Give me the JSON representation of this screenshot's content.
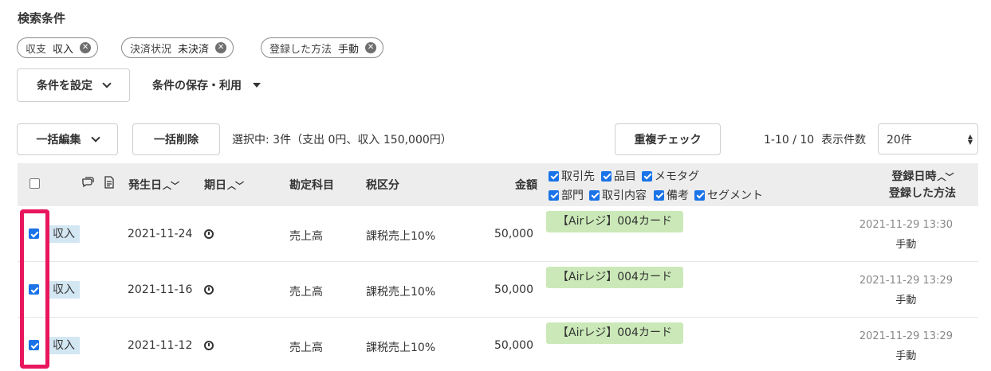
{
  "search": {
    "title": "検索条件",
    "chips": [
      {
        "label": "収支",
        "value": "収入"
      },
      {
        "label": "決済状況",
        "value": "未決済"
      },
      {
        "label": "登録した方法",
        "value": "手動"
      }
    ],
    "set_conditions_label": "条件を設定",
    "save_use_label": "条件の保存・利用"
  },
  "toolbar": {
    "bulk_edit_label": "一括編集",
    "bulk_delete_label": "一括削除",
    "selection_text": "選択中: 3件（支出 0円、収入 150,000円）",
    "duplicate_check_label": "重複チェック",
    "pagination_text": "1-10 / 10  表示件数",
    "per_page_value": "20件"
  },
  "table": {
    "headers": {
      "date": "発生日",
      "due": "期日",
      "account": "勘定科目",
      "tax": "税区分",
      "amount": "金額",
      "registered_line1": "登録日時",
      "registered_line2": "登録した方法"
    },
    "column_options": [
      {
        "label": "取引先",
        "checked": true
      },
      {
        "label": "品目",
        "checked": true
      },
      {
        "label": "メモタグ",
        "checked": true
      },
      {
        "label": "部門",
        "checked": true
      },
      {
        "label": "取引内容",
        "checked": true
      },
      {
        "label": "備考",
        "checked": true
      },
      {
        "label": "セグメント",
        "checked": true
      }
    ],
    "rows": [
      {
        "checked": true,
        "kind": "収入",
        "date": "2021-11-24",
        "account": "売上高",
        "tax": "課税売上10%",
        "amount": "50,000",
        "partner_tag": "【Airレジ】004カード",
        "registered_at": "2021-11-29 13:30",
        "method": "手動"
      },
      {
        "checked": true,
        "kind": "収入",
        "date": "2021-11-16",
        "account": "売上高",
        "tax": "課税売上10%",
        "amount": "50,000",
        "partner_tag": "【Airレジ】004カード",
        "registered_at": "2021-11-29 13:29",
        "method": "手動"
      },
      {
        "checked": true,
        "kind": "収入",
        "date": "2021-11-12",
        "account": "売上高",
        "tax": "課税売上10%",
        "amount": "50,000",
        "partner_tag": "【Airレジ】004カード",
        "registered_at": "2021-11-29 13:29",
        "method": "手動"
      }
    ]
  },
  "colors": {
    "accent_checkbox": "#1a73e8",
    "kind_tag_bg": "#d3e7f3",
    "partner_tag_bg": "#cbe9b8",
    "highlight_border": "#e8175d",
    "header_bg": "#ededed"
  },
  "icons": {
    "chip_close": "close-circle-icon",
    "comment": "comment-icon",
    "document": "document-icon",
    "due": "clock-icon",
    "sort": "sort-arrows-icon"
  }
}
